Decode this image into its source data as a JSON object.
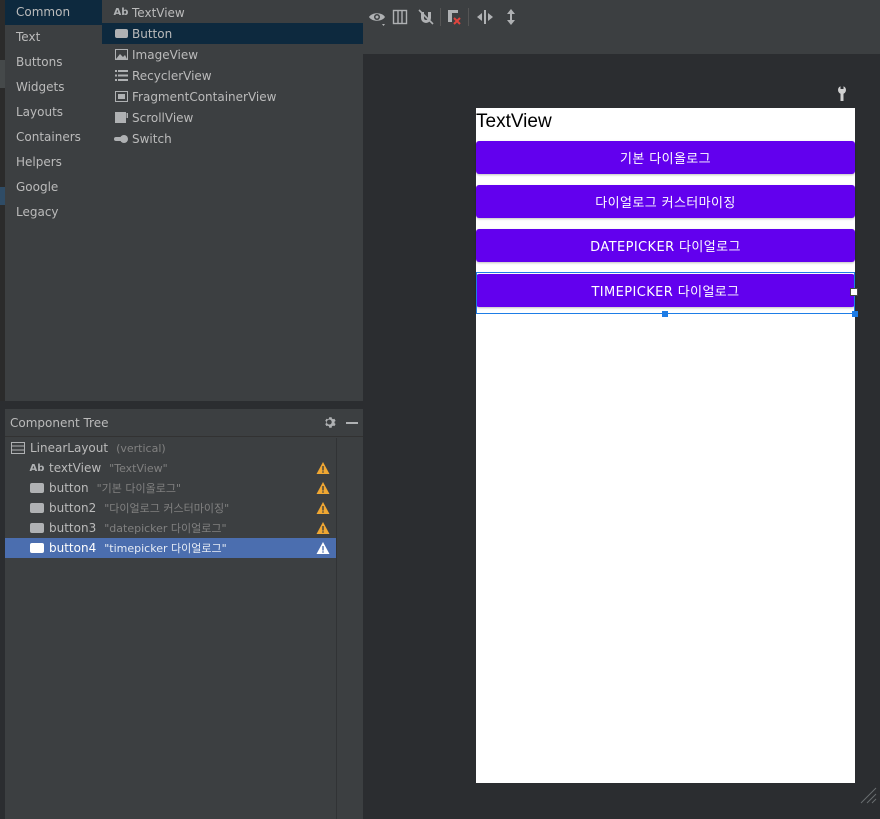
{
  "palette": {
    "categories": [
      "Common",
      "Text",
      "Buttons",
      "Widgets",
      "Layouts",
      "Containers",
      "Helpers",
      "Google",
      "Legacy"
    ],
    "widgets": [
      {
        "label": "TextView",
        "icon": "ab-text-icon"
      },
      {
        "label": "Button",
        "icon": "button-icon"
      },
      {
        "label": "ImageView",
        "icon": "image-icon"
      },
      {
        "label": "RecyclerView",
        "icon": "list-icon"
      },
      {
        "label": "FragmentContainerView",
        "icon": "fragment-icon"
      },
      {
        "label": "ScrollView",
        "icon": "scroll-icon"
      },
      {
        "label": "Switch",
        "icon": "switch-icon"
      }
    ],
    "ab_glyph": "Ab"
  },
  "component_tree": {
    "title": "Component Tree",
    "root": {
      "name": "LinearLayout",
      "desc": "(vertical)"
    },
    "children": [
      {
        "name": "textView",
        "desc": "\"TextView\"",
        "icon": "ab-text-icon",
        "warning": true
      },
      {
        "name": "button",
        "desc": "\"기본 다이올로그\"",
        "icon": "button-icon",
        "warning": true
      },
      {
        "name": "button2",
        "desc": "\"다이얼로그 커스터마이징\"",
        "icon": "button-icon",
        "warning": true
      },
      {
        "name": "button3",
        "desc": "\"datepicker 다이얼로그\"",
        "icon": "button-icon",
        "warning": true
      },
      {
        "name": "button4",
        "desc": "\"timepicker 다이얼로그\"",
        "icon": "button-icon",
        "warning": true,
        "selected": true
      }
    ]
  },
  "preview": {
    "textview": "TextView",
    "buttons": [
      "기본 다이올로그",
      "다이얼로그 커스터마이징",
      "DATEPICKER 다이얼로그",
      "TIMEPICKER 다이얼로그"
    ],
    "button_color": "#6200ee"
  },
  "colors": {
    "selection": "#4b6eaf",
    "warning": "#f0a732",
    "active_item": "#0d293e"
  }
}
